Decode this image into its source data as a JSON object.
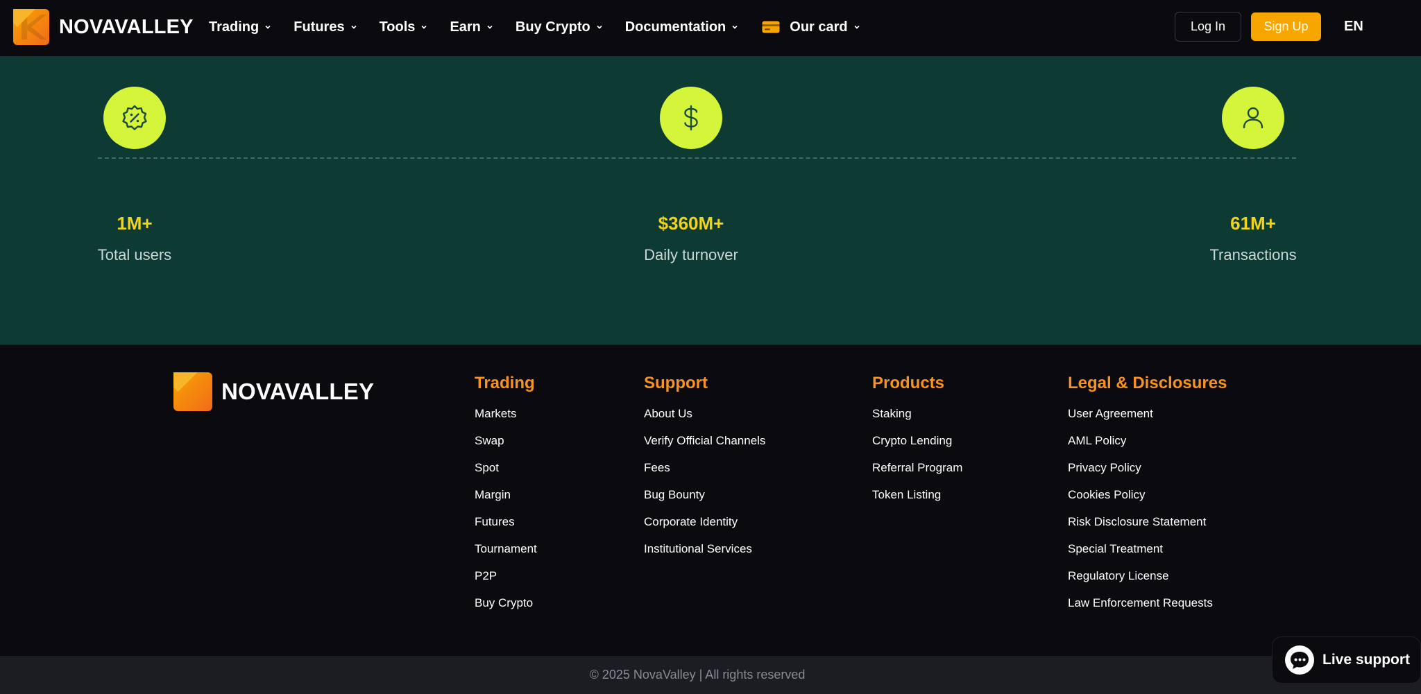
{
  "brand": {
    "name": "NOVAVALLEY"
  },
  "nav": {
    "items": [
      {
        "label": "Trading"
      },
      {
        "label": "Futures"
      },
      {
        "label": "Tools"
      },
      {
        "label": "Earn"
      },
      {
        "label": "Buy Crypto"
      },
      {
        "label": "Documentation"
      },
      {
        "label": "Our card"
      }
    ],
    "login_label": "Log In",
    "signup_label": "Sign Up",
    "language": "EN"
  },
  "stats": [
    {
      "icon": "discount-badge-icon",
      "value": "1M+",
      "label": "Total users"
    },
    {
      "icon": "dollar-icon",
      "value": "$360M+",
      "label": "Daily turnover"
    },
    {
      "icon": "user-icon",
      "value": "61M+",
      "label": "Transactions"
    }
  ],
  "footer": {
    "columns": [
      {
        "title": "Trading",
        "links": [
          "Markets",
          "Swap",
          "Spot",
          "Margin",
          "Futures",
          "Tournament",
          "P2P",
          "Buy Crypto"
        ]
      },
      {
        "title": "Support",
        "links": [
          "About Us",
          "Verify Official Channels",
          "Fees",
          "Bug Bounty",
          "Corporate Identity",
          "Institutional Services"
        ]
      },
      {
        "title": "Products",
        "links": [
          "Staking",
          "Crypto Lending",
          "Referral Program",
          "Token Listing"
        ]
      },
      {
        "title": "Legal & Disclosures",
        "links": [
          "User Agreement",
          "AML Policy",
          "Privacy Policy",
          "Cookies Policy",
          "Risk Disclosure Statement",
          "Special Treatment",
          "Regulatory License",
          "Law Enforcement Requests"
        ]
      }
    ],
    "copyright": "© 2025 NovaValley | All rights reserved"
  },
  "live_support": {
    "label": "Live support"
  },
  "colors": {
    "accent": "#f7a600",
    "band": "#0d3a32",
    "icon_bg": "#d4f53a",
    "stat_value": "#f1d31a",
    "column_title": "#f7931e"
  }
}
